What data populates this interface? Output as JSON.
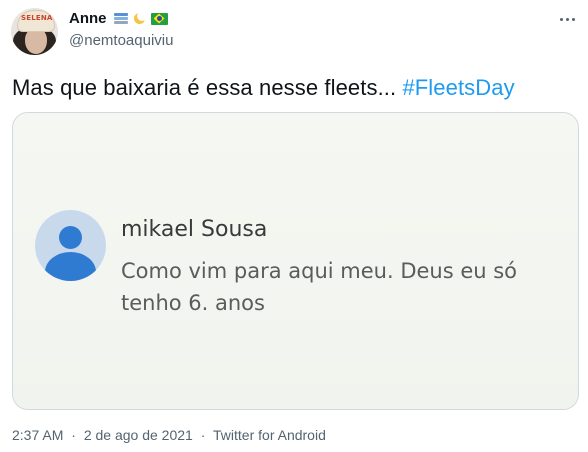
{
  "user": {
    "display_name": "Anne",
    "handle": "@nemtoaquiviu",
    "avatar_cap_text": "SELENA",
    "emoji_icons": [
      "books-icon",
      "crescent-moon-icon",
      "brazil-flag-icon"
    ]
  },
  "tweet": {
    "text": "Mas que baixaria é essa nesse fleets... ",
    "hashtag": "#FleetsDay"
  },
  "media": {
    "comment_author": "mikael Sousa",
    "comment_text": "Como vim para  aqui meu. Deus eu só tenho 6. anos"
  },
  "footer": {
    "time": "2:37 AM",
    "date": "2 de ago de 2021",
    "separator": "·",
    "source": "Twitter for Android"
  },
  "colors": {
    "link": "#1d9bf0",
    "secondary_text": "#536471",
    "border": "#cfd9de"
  }
}
